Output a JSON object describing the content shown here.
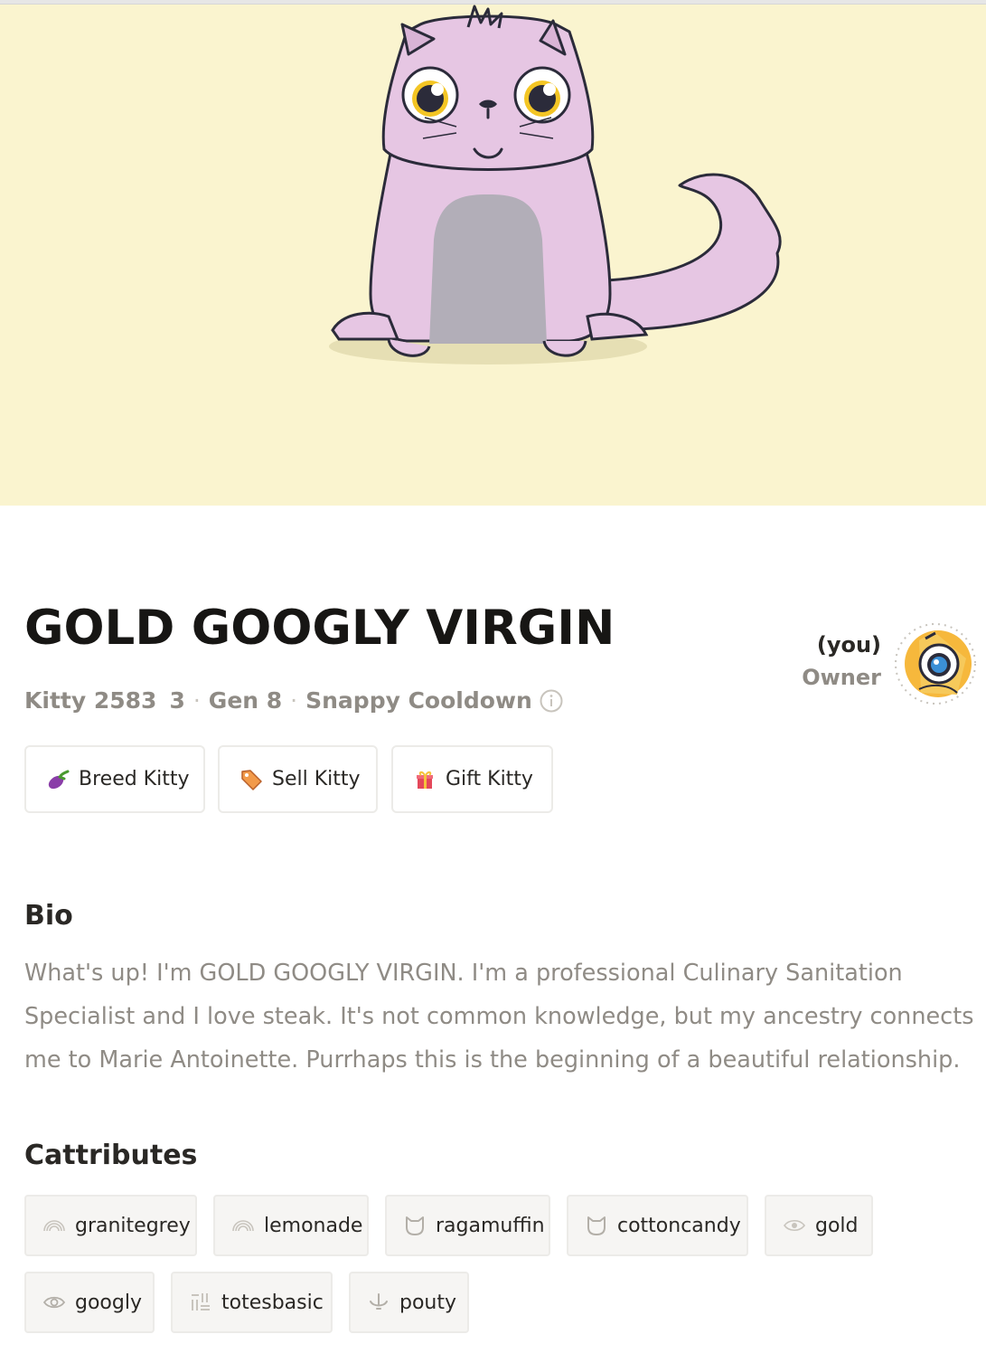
{
  "kitty": {
    "name": "GOLD GOOGLY VIRGIN",
    "id_text": "Kitty 2583",
    "id_suffix": "3",
    "generation": "Gen 8",
    "cooldown": "Snappy Cooldown",
    "hero_bg": "#faf4cf"
  },
  "owner": {
    "you_label": "(you)",
    "owner_label": "Owner"
  },
  "actions": {
    "breed": "Breed Kitty",
    "sell": "Sell Kitty",
    "gift": "Gift Kitty"
  },
  "bio": {
    "heading": "Bio",
    "text": "What's up! I'm GOLD GOOGLY VIRGIN. I'm a professional Culinary Sanitation Specialist and I love steak. It's not common knowledge, but my ancestry connects me to Marie Antoinette. Purrhaps this is the beginning of a beautiful relationship."
  },
  "cattributes": {
    "heading": "Cattributes",
    "items": [
      {
        "label": "granitegrey",
        "icon": "rainbow-icon"
      },
      {
        "label": "lemonade",
        "icon": "rainbow-icon"
      },
      {
        "label": "ragamuffin",
        "icon": "cat-head-icon"
      },
      {
        "label": "cottoncandy",
        "icon": "cat-head-icon"
      },
      {
        "label": "gold",
        "icon": "eye-icon"
      },
      {
        "label": "googly",
        "icon": "eye-icon"
      },
      {
        "label": "totesbasic",
        "icon": "pattern-icon"
      },
      {
        "label": "pouty",
        "icon": "mouth-icon"
      }
    ]
  }
}
